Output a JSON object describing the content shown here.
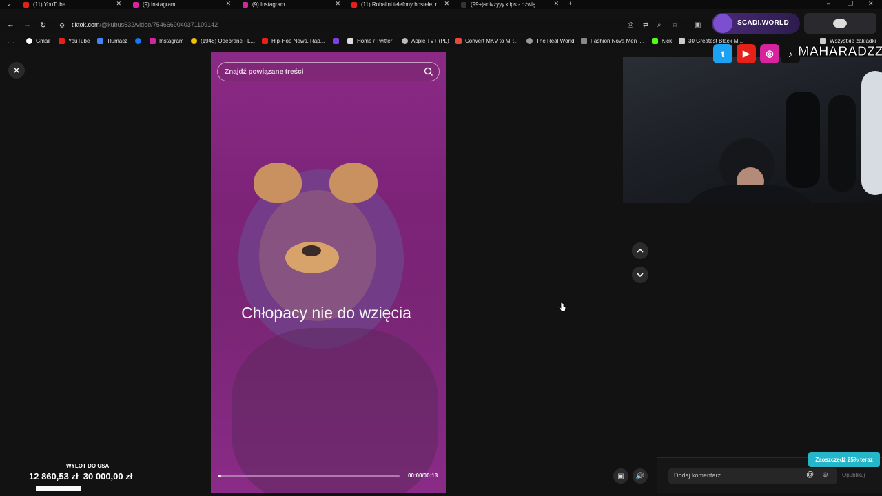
{
  "tabs": [
    {
      "title": "(11) YouTube",
      "color": "#e62117"
    },
    {
      "title": "(9) Instagram",
      "color": "#d6249f"
    },
    {
      "title": "(9) Instagram",
      "color": "#d6249f"
    },
    {
      "title": "(11) Robalini telefony hostele, r",
      "color": "#e62117"
    },
    {
      "title": "(99+)snivzyyy.klips - dźwię",
      "color": "#222222"
    }
  ],
  "address": {
    "host": "tiktok.com",
    "path": "/@kubus632/video/7546669040371109142"
  },
  "bookmarks": [
    {
      "label": "Gmail",
      "color": "#ffffff"
    },
    {
      "label": "YouTube",
      "color": "#e62117"
    },
    {
      "label": "Tłumacz",
      "color": "#4285f4"
    },
    {
      "label": "",
      "color": "#1877f2"
    },
    {
      "label": "Instagram",
      "color": "#d6249f"
    },
    {
      "label": "(1948) Odebrane - L...",
      "color": "#f2c200"
    },
    {
      "label": "Hip-Hop News, Rap...",
      "color": "#e62117"
    },
    {
      "label": "",
      "color": "#7b3fe4"
    },
    {
      "label": "Home / Twitter",
      "color": "#dddddd"
    },
    {
      "label": "Apple TV+ (PL)",
      "color": "#bbbbbb"
    },
    {
      "label": "Convert MKV to MP...",
      "color": "#e64a3b"
    },
    {
      "label": "The Real World",
      "color": "#999999"
    },
    {
      "label": "Fashion Nova Men |...",
      "color": "#888888"
    },
    {
      "label": "Kick",
      "color": "#53fc18"
    },
    {
      "label": "30 Greatest Black M...",
      "color": "#cccccc"
    },
    {
      "label": "Wszystkie zakładki",
      "color": "#cccccc"
    }
  ],
  "video": {
    "search_placeholder": "Znajdź powiązane treści",
    "caption": "Chłopacy nie do wzięcia",
    "timecode": "00:00/00:13",
    "progress": 0.02
  },
  "comments": {
    "placeholder": "Dodaj komentarz...",
    "post_label": "Opublikuj",
    "promo": "Zaoszczędź 25% teraz"
  },
  "overlay": {
    "scadi": "SCADI.WORLD",
    "handle": "MAHARADZZA",
    "goal_title": "WYLOT DO USA",
    "goal_current": "12 860,53 zł",
    "goal_target": "30 000,00 zł",
    "goal_fraction": 0.43
  },
  "colors": {
    "accent": "#25b7c9",
    "video_bg": "#7c2378"
  }
}
